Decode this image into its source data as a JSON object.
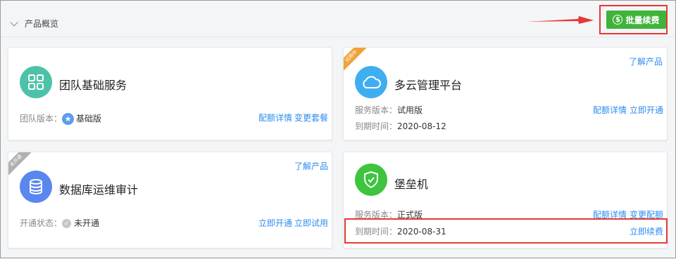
{
  "header": {
    "title": "产品概览",
    "renew_button": "批量续费"
  },
  "cards": [
    {
      "name": "团队基础服务",
      "meta_label": "团队版本：",
      "meta_value": "基础版",
      "links": [
        "配额详情",
        "变更套餐"
      ]
    },
    {
      "name": "多云管理平台",
      "ribbon": "试用中",
      "top_link": "了解产品",
      "meta_label": "服务版本：",
      "meta_value": "试用版",
      "expire_label": "到期时间：",
      "expire_value": "2020-08-12",
      "links": [
        "配额详情",
        "立即开通"
      ]
    },
    {
      "name": "数据库运维审计",
      "ribbon": "未开通",
      "top_link": "了解产品",
      "meta_label": "开通状态：",
      "meta_value": "未开通",
      "links": [
        "立即开通",
        "立即试用"
      ]
    },
    {
      "name": "堡垒机",
      "meta_label": "服务版本：",
      "meta_value": "正式版",
      "expire_label": "到期时间：",
      "expire_value": "2020-08-31",
      "links": [
        "配额详情",
        "变更配额"
      ],
      "renew_link": "立即续费"
    }
  ],
  "colors": {
    "accent_blue": "#2d8cf0",
    "renew_green": "#3fb33a",
    "highlight_red": "#e53935",
    "team_icon_bg": "#4cc3a8",
    "cloud_icon_bg": "#3eaef0",
    "db_icon_bg": "#5a86f0",
    "bastion_icon_bg": "#3ec43e",
    "trial_ribbon": "#f0a23a",
    "inactive_ribbon": "#b0b0b0"
  },
  "icons": [
    "chevron-down-icon",
    "dollar-icon",
    "grid-icon",
    "cloud-icon",
    "database-icon",
    "shield-check-icon",
    "star-icon",
    "check-icon"
  ]
}
